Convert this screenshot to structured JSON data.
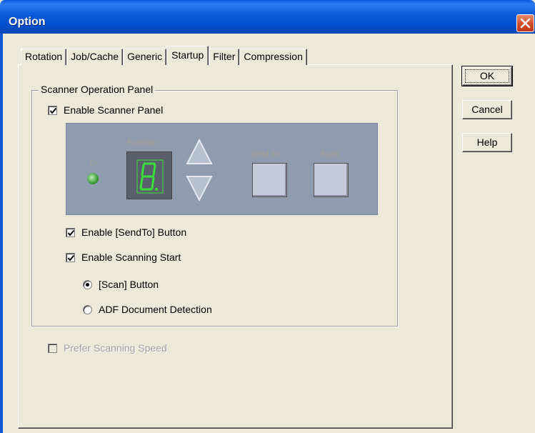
{
  "window": {
    "title": "Option"
  },
  "tabs": [
    {
      "label": "Rotation"
    },
    {
      "label": "Job/Cache"
    },
    {
      "label": "Generic"
    },
    {
      "label": "Startup",
      "active": true
    },
    {
      "label": "Filter"
    },
    {
      "label": "Compression"
    }
  ],
  "buttons": {
    "ok": "OK",
    "cancel": "Cancel",
    "help": "Help"
  },
  "group": {
    "title": "Scanner Operation Panel"
  },
  "options": {
    "enable_scanner_panel": {
      "label": "Enable Scanner Panel",
      "checked": true
    },
    "enable_sendto_button": {
      "label": "Enable [SendTo] Button",
      "checked": true
    },
    "enable_scanning_start": {
      "label": "Enable Scanning Start",
      "checked": true
    },
    "scan_button": {
      "label": "[Scan] Button",
      "selected": true
    },
    "adf_detection": {
      "label": "ADF Document Detection",
      "selected": false
    },
    "prefer_scanning_speed": {
      "label": "Prefer Scanning Speed",
      "checked": false,
      "disabled": true
    }
  },
  "scanner_panel": {
    "function_label": "Function",
    "sendto_label": "Send To",
    "scan_label": "Scan",
    "digit": "8.",
    "colors": {
      "panel": "#8f9cae",
      "digit": "#39e03a",
      "led": "#3c9a3c"
    }
  }
}
